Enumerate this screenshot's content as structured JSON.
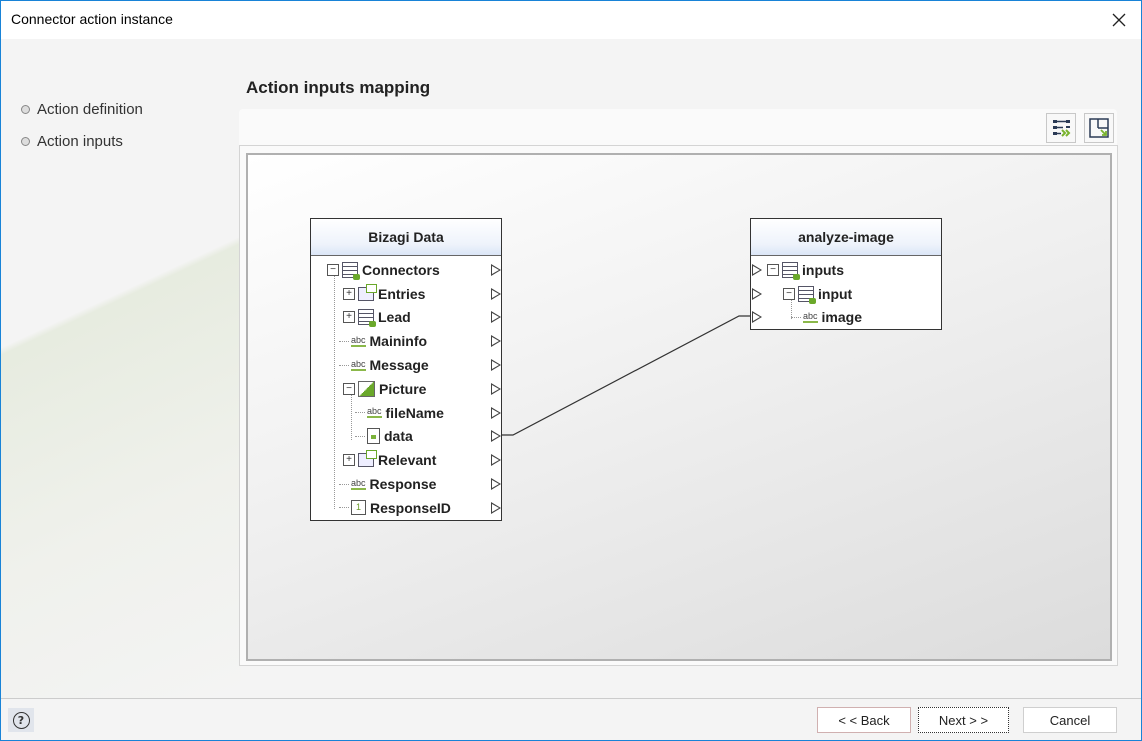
{
  "window": {
    "title": "Connector action instance",
    "close_icon": "close-icon"
  },
  "steps": [
    {
      "label": "Action definition"
    },
    {
      "label": "Action inputs"
    }
  ],
  "main": {
    "heading": "Action inputs mapping",
    "toolbar": {
      "auto_map_icon": "auto-map-icon",
      "layout_icon": "layout-icon"
    }
  },
  "source_node": {
    "title": "Bizagi Data",
    "rows": [
      {
        "label": "Connectors",
        "icon": "table-icon",
        "expander": "-"
      },
      {
        "label": "Entries",
        "icon": "collection-icon",
        "expander": "+"
      },
      {
        "label": "Lead",
        "icon": "table-icon",
        "expander": "+"
      },
      {
        "label": "Maininfo",
        "icon": "text-attribute-icon",
        "expander": ""
      },
      {
        "label": "Message",
        "icon": "text-attribute-icon",
        "expander": ""
      },
      {
        "label": "Picture",
        "icon": "image-icon",
        "expander": "-"
      },
      {
        "label": "fileName",
        "icon": "text-attribute-icon",
        "expander": ""
      },
      {
        "label": "data",
        "icon": "file-icon",
        "expander": ""
      },
      {
        "label": "Relevant",
        "icon": "collection-icon",
        "expander": "+"
      },
      {
        "label": "Response",
        "icon": "text-attribute-icon",
        "expander": ""
      },
      {
        "label": "ResponseID",
        "icon": "number-attribute-icon",
        "expander": "",
        "num_glyph": "1"
      }
    ]
  },
  "target_node": {
    "title": "analyze-image",
    "rows": [
      {
        "label": "inputs",
        "icon": "table-icon",
        "expander": "-"
      },
      {
        "label": "input",
        "icon": "table-icon",
        "expander": "-"
      },
      {
        "label": "image",
        "icon": "text-attribute-icon",
        "expander": ""
      }
    ]
  },
  "mapping": {
    "from": "data",
    "to": "image"
  },
  "footer": {
    "help_glyph": "?",
    "back_label": "< < Back",
    "next_label": "Next > >",
    "cancel_label": "Cancel"
  }
}
